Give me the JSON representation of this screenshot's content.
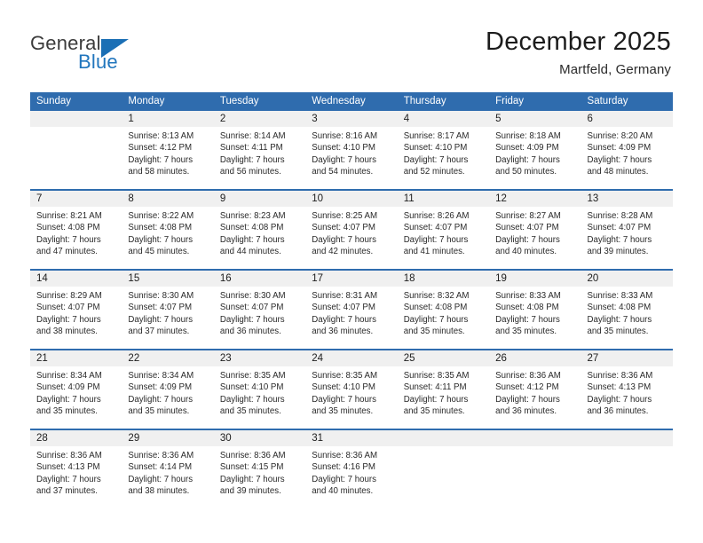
{
  "brand": {
    "name_part1": "General",
    "name_part2": "Blue"
  },
  "header": {
    "title": "December 2025",
    "subtitle": "Martfeld, Germany"
  },
  "colors": {
    "header_blue": "#2f6cae",
    "brand_blue": "#2176bd",
    "daynum_band": "#f0f0f0",
    "text": "#1a1a1a"
  },
  "calendar": {
    "weekdays": [
      "Sunday",
      "Monday",
      "Tuesday",
      "Wednesday",
      "Thursday",
      "Friday",
      "Saturday"
    ],
    "weeks": [
      [
        {
          "day": "",
          "empty": true,
          "lines": [
            "",
            "",
            "",
            ""
          ]
        },
        {
          "day": "1",
          "lines": [
            "Sunrise: 8:13 AM",
            "Sunset: 4:12 PM",
            "Daylight: 7 hours",
            "and 58 minutes."
          ]
        },
        {
          "day": "2",
          "lines": [
            "Sunrise: 8:14 AM",
            "Sunset: 4:11 PM",
            "Daylight: 7 hours",
            "and 56 minutes."
          ]
        },
        {
          "day": "3",
          "lines": [
            "Sunrise: 8:16 AM",
            "Sunset: 4:10 PM",
            "Daylight: 7 hours",
            "and 54 minutes."
          ]
        },
        {
          "day": "4",
          "lines": [
            "Sunrise: 8:17 AM",
            "Sunset: 4:10 PM",
            "Daylight: 7 hours",
            "and 52 minutes."
          ]
        },
        {
          "day": "5",
          "lines": [
            "Sunrise: 8:18 AM",
            "Sunset: 4:09 PM",
            "Daylight: 7 hours",
            "and 50 minutes."
          ]
        },
        {
          "day": "6",
          "lines": [
            "Sunrise: 8:20 AM",
            "Sunset: 4:09 PM",
            "Daylight: 7 hours",
            "and 48 minutes."
          ]
        }
      ],
      [
        {
          "day": "7",
          "lines": [
            "Sunrise: 8:21 AM",
            "Sunset: 4:08 PM",
            "Daylight: 7 hours",
            "and 47 minutes."
          ]
        },
        {
          "day": "8",
          "lines": [
            "Sunrise: 8:22 AM",
            "Sunset: 4:08 PM",
            "Daylight: 7 hours",
            "and 45 minutes."
          ]
        },
        {
          "day": "9",
          "lines": [
            "Sunrise: 8:23 AM",
            "Sunset: 4:08 PM",
            "Daylight: 7 hours",
            "and 44 minutes."
          ]
        },
        {
          "day": "10",
          "lines": [
            "Sunrise: 8:25 AM",
            "Sunset: 4:07 PM",
            "Daylight: 7 hours",
            "and 42 minutes."
          ]
        },
        {
          "day": "11",
          "lines": [
            "Sunrise: 8:26 AM",
            "Sunset: 4:07 PM",
            "Daylight: 7 hours",
            "and 41 minutes."
          ]
        },
        {
          "day": "12",
          "lines": [
            "Sunrise: 8:27 AM",
            "Sunset: 4:07 PM",
            "Daylight: 7 hours",
            "and 40 minutes."
          ]
        },
        {
          "day": "13",
          "lines": [
            "Sunrise: 8:28 AM",
            "Sunset: 4:07 PM",
            "Daylight: 7 hours",
            "and 39 minutes."
          ]
        }
      ],
      [
        {
          "day": "14",
          "lines": [
            "Sunrise: 8:29 AM",
            "Sunset: 4:07 PM",
            "Daylight: 7 hours",
            "and 38 minutes."
          ]
        },
        {
          "day": "15",
          "lines": [
            "Sunrise: 8:30 AM",
            "Sunset: 4:07 PM",
            "Daylight: 7 hours",
            "and 37 minutes."
          ]
        },
        {
          "day": "16",
          "lines": [
            "Sunrise: 8:30 AM",
            "Sunset: 4:07 PM",
            "Daylight: 7 hours",
            "and 36 minutes."
          ]
        },
        {
          "day": "17",
          "lines": [
            "Sunrise: 8:31 AM",
            "Sunset: 4:07 PM",
            "Daylight: 7 hours",
            "and 36 minutes."
          ]
        },
        {
          "day": "18",
          "lines": [
            "Sunrise: 8:32 AM",
            "Sunset: 4:08 PM",
            "Daylight: 7 hours",
            "and 35 minutes."
          ]
        },
        {
          "day": "19",
          "lines": [
            "Sunrise: 8:33 AM",
            "Sunset: 4:08 PM",
            "Daylight: 7 hours",
            "and 35 minutes."
          ]
        },
        {
          "day": "20",
          "lines": [
            "Sunrise: 8:33 AM",
            "Sunset: 4:08 PM",
            "Daylight: 7 hours",
            "and 35 minutes."
          ]
        }
      ],
      [
        {
          "day": "21",
          "lines": [
            "Sunrise: 8:34 AM",
            "Sunset: 4:09 PM",
            "Daylight: 7 hours",
            "and 35 minutes."
          ]
        },
        {
          "day": "22",
          "lines": [
            "Sunrise: 8:34 AM",
            "Sunset: 4:09 PM",
            "Daylight: 7 hours",
            "and 35 minutes."
          ]
        },
        {
          "day": "23",
          "lines": [
            "Sunrise: 8:35 AM",
            "Sunset: 4:10 PM",
            "Daylight: 7 hours",
            "and 35 minutes."
          ]
        },
        {
          "day": "24",
          "lines": [
            "Sunrise: 8:35 AM",
            "Sunset: 4:10 PM",
            "Daylight: 7 hours",
            "and 35 minutes."
          ]
        },
        {
          "day": "25",
          "lines": [
            "Sunrise: 8:35 AM",
            "Sunset: 4:11 PM",
            "Daylight: 7 hours",
            "and 35 minutes."
          ]
        },
        {
          "day": "26",
          "lines": [
            "Sunrise: 8:36 AM",
            "Sunset: 4:12 PM",
            "Daylight: 7 hours",
            "and 36 minutes."
          ]
        },
        {
          "day": "27",
          "lines": [
            "Sunrise: 8:36 AM",
            "Sunset: 4:13 PM",
            "Daylight: 7 hours",
            "and 36 minutes."
          ]
        }
      ],
      [
        {
          "day": "28",
          "lines": [
            "Sunrise: 8:36 AM",
            "Sunset: 4:13 PM",
            "Daylight: 7 hours",
            "and 37 minutes."
          ]
        },
        {
          "day": "29",
          "lines": [
            "Sunrise: 8:36 AM",
            "Sunset: 4:14 PM",
            "Daylight: 7 hours",
            "and 38 minutes."
          ]
        },
        {
          "day": "30",
          "lines": [
            "Sunrise: 8:36 AM",
            "Sunset: 4:15 PM",
            "Daylight: 7 hours",
            "and 39 minutes."
          ]
        },
        {
          "day": "31",
          "lines": [
            "Sunrise: 8:36 AM",
            "Sunset: 4:16 PM",
            "Daylight: 7 hours",
            "and 40 minutes."
          ]
        },
        {
          "day": "",
          "empty": true,
          "lines": [
            "",
            "",
            "",
            ""
          ]
        },
        {
          "day": "",
          "empty": true,
          "lines": [
            "",
            "",
            "",
            ""
          ]
        },
        {
          "day": "",
          "empty": true,
          "lines": [
            "",
            "",
            "",
            ""
          ]
        }
      ]
    ]
  }
}
